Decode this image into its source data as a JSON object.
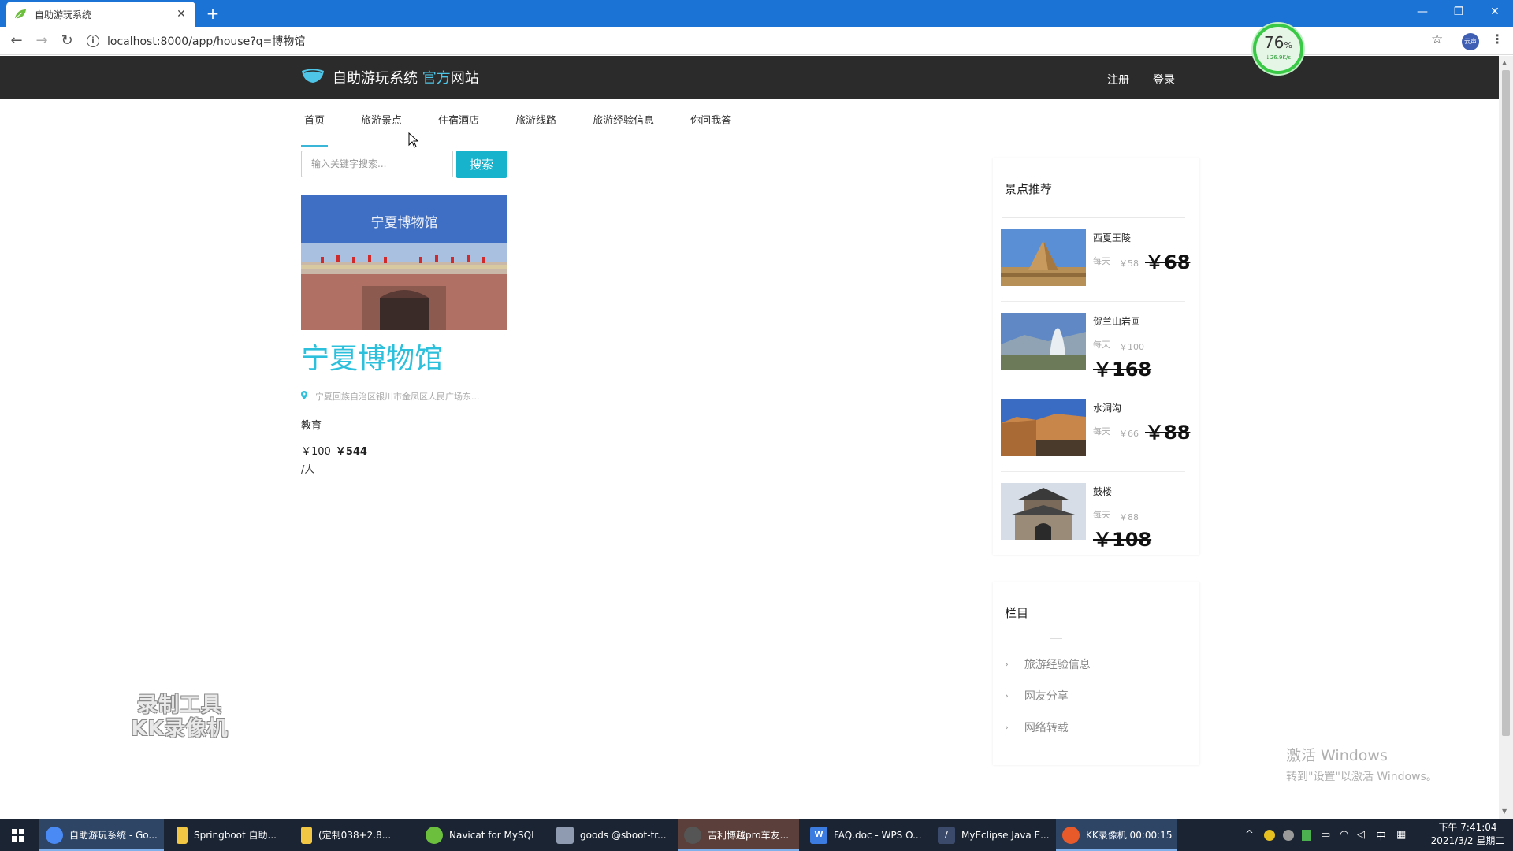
{
  "browser": {
    "tab_title": "自助游玩系统",
    "url": "localhost:8000/app/house?q=博物馆",
    "profile_label": "云声"
  },
  "net_widget": {
    "percent": "76",
    "percent_unit": "%",
    "speed": "↓26.9K/s"
  },
  "site": {
    "logo_main": "自助游玩系统 ",
    "logo_accent": "官方",
    "logo_suffix": "网站",
    "register": "注册",
    "login": "登录"
  },
  "nav": {
    "items": [
      {
        "label": "首页"
      },
      {
        "label": "旅游景点"
      },
      {
        "label": "住宿酒店"
      },
      {
        "label": "旅游线路"
      },
      {
        "label": "旅游经验信息"
      },
      {
        "label": "你问我答"
      }
    ]
  },
  "search": {
    "placeholder": "输入关键字搜索...",
    "button": "搜索"
  },
  "result": {
    "photo_sign": "宁夏博物馆",
    "name": "宁夏博物馆",
    "address": "宁夏回族自治区银川市金凤区人民广场东...",
    "category": "教育",
    "price": "￥100",
    "original_price": "￥544",
    "unit": "/人"
  },
  "sidebar": {
    "rec_title": "景点推荐",
    "spots": [
      {
        "name": "西夏王陵",
        "daily": "每天",
        "orig": "￥58",
        "price": "￥68"
      },
      {
        "name": "贺兰山岩画",
        "daily": "每天",
        "orig": "￥100",
        "price": "￥168"
      },
      {
        "name": "水洞沟",
        "daily": "每天",
        "orig": "￥66",
        "price": "￥88"
      },
      {
        "name": "鼓楼",
        "daily": "每天",
        "orig": "￥88",
        "price": "￥108"
      }
    ],
    "cat_title": "栏目",
    "categories": [
      {
        "label": "旅游经验信息"
      },
      {
        "label": "网友分享"
      },
      {
        "label": "网络转载"
      }
    ]
  },
  "watermark": {
    "line1": "录制工具",
    "line2": "KK录像机"
  },
  "activation": {
    "line1": "激活 Windows",
    "line2": "转到\"设置\"以激活 Windows。"
  },
  "taskbar": {
    "items": [
      {
        "label": "自助游玩系统 - Go...",
        "color": "#4a8af4"
      },
      {
        "label": "Springboot 自助...",
        "color": "#f2c744"
      },
      {
        "label": "(定制038+2.8...",
        "color": "#f2c744"
      },
      {
        "label": "Navicat for MySQL",
        "color": "#6cbf3d"
      },
      {
        "label": "goods @sboot-tr...",
        "color": "#8e9bb0"
      },
      {
        "label": "吉利博越pro车友...",
        "color": "#555555"
      },
      {
        "label": "FAQ.doc - WPS O...",
        "color": "#3c7be0"
      },
      {
        "label": "MyEclipse Java E...",
        "color": "#3b4a6b"
      },
      {
        "label": "KK录像机 00:00:15",
        "color": "#e85a2a"
      }
    ],
    "ime": "中",
    "time": "下午 7:41:04",
    "date": "2021/3/2 星期二"
  }
}
